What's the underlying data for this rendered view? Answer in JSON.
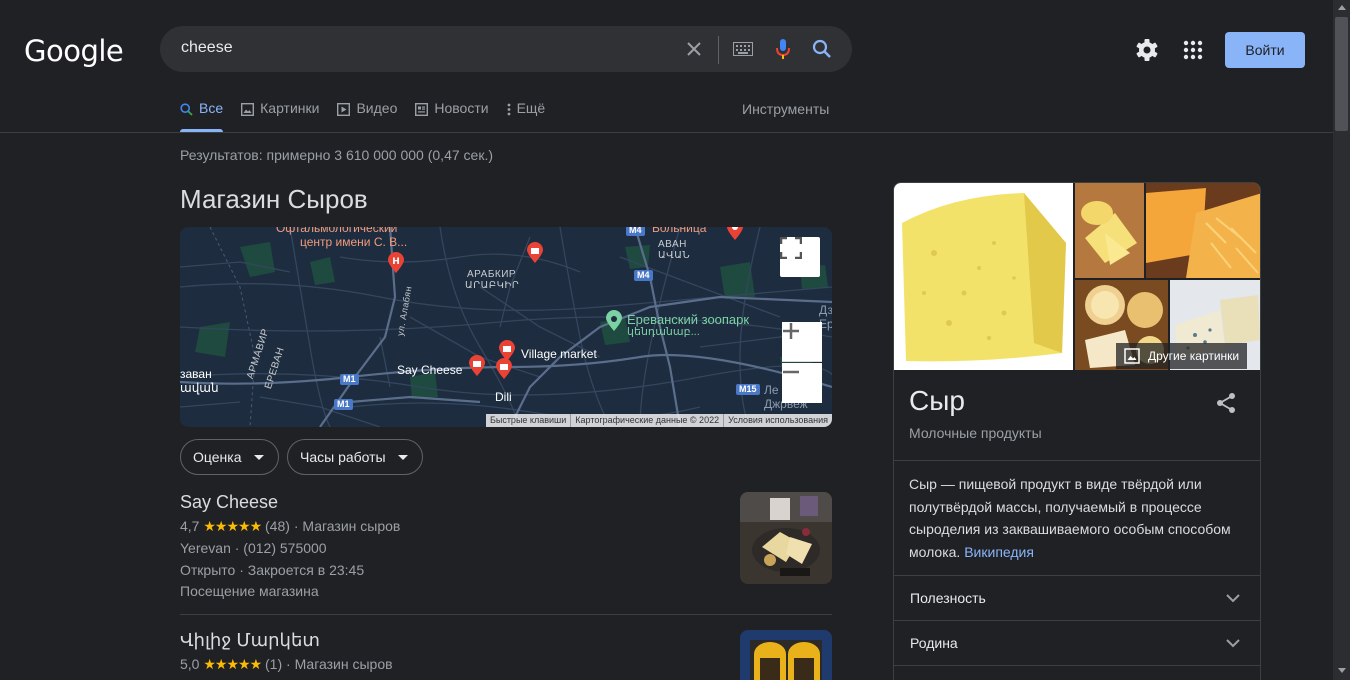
{
  "header": {
    "logo": "Google",
    "search_value": "cheese",
    "login_label": "Войти"
  },
  "tabs": [
    {
      "label": "Все",
      "icon": "search-icon",
      "active": true
    },
    {
      "label": "Картинки",
      "icon": "image-icon",
      "active": false
    },
    {
      "label": "Видео",
      "icon": "video-icon",
      "active": false
    },
    {
      "label": "Новости",
      "icon": "news-icon",
      "active": false
    },
    {
      "label": "Ещё",
      "icon": "more-vert-icon",
      "active": false
    }
  ],
  "tools_label": "Инструменты",
  "result_stats": "Результатов: примерно 3 610 000 000 (0,47 сек.)",
  "local": {
    "title": "Магазин Сыров",
    "map": {
      "labels": {
        "ophthalm": "Офтальмологический",
        "ophthalm2": "центр имени С. В...",
        "hospital": "Больница",
        "avan": "АВАН",
        "avan_arm": "ԱՎԱՆ",
        "arabkir": "АРАБКИР",
        "arabkir_arm": "ԱՐԱԲԿԻՐ",
        "zoo": "Ереванский зоопарк",
        "zoo_arm": "Երևանի",
        "zoo_arm2": "կենդանաբ...",
        "say_cheese": "Say Cheese",
        "village_market": "Village market",
        "dili": "Dili",
        "armavir": "АРМАВИР",
        "erevan": "ЕРЕВАН",
        "zavan": "заван",
        "zavan_arm": "ավան",
        "street": "ул. Алабян",
        "dz": "Дз",
        "er": "Ер",
        "le": "Ле",
        "dzhrvezh": "Джрвеж"
      },
      "roads": {
        "m4a": "M4",
        "m4b": "M4",
        "m1a": "M1",
        "m1b": "M1",
        "m15": "M15"
      },
      "footer": [
        "Быстрые клавиши",
        "Картографические данные © 2022",
        "Условия использования"
      ]
    },
    "filters": [
      "Оценка",
      "Часы работы"
    ],
    "listings": [
      {
        "name": "Say Cheese",
        "rating": "4,7",
        "stars": "★★★★★",
        "reviews": "(48)",
        "category": "Магазин сыров",
        "address": "Yerevan · (012) 575000",
        "hours": "Открыто · Закроется в 23:45",
        "extra": "Посещение магазина"
      },
      {
        "name": "Վիլիջ Մարկետ",
        "rating": "5,0",
        "stars": "★★★★★",
        "reviews": "(1)",
        "category": "Магазин сыров"
      }
    ]
  },
  "knowledge_panel": {
    "more_images": "Другие картинки",
    "title": "Сыр",
    "subtitle": "Молочные продукты",
    "description": "Сыр — пищевой продукт в виде твёрдой или полутвёрдой массы, получаемый в процессе сыроделия из заквашиваемого особым способом молока.",
    "source_link": "Википедия",
    "accordions": [
      "Полезность",
      "Родина"
    ]
  },
  "colors": {
    "background": "#202124",
    "accent": "#8ab4f8",
    "star": "#fbbc04",
    "pin": "#ea4335"
  }
}
